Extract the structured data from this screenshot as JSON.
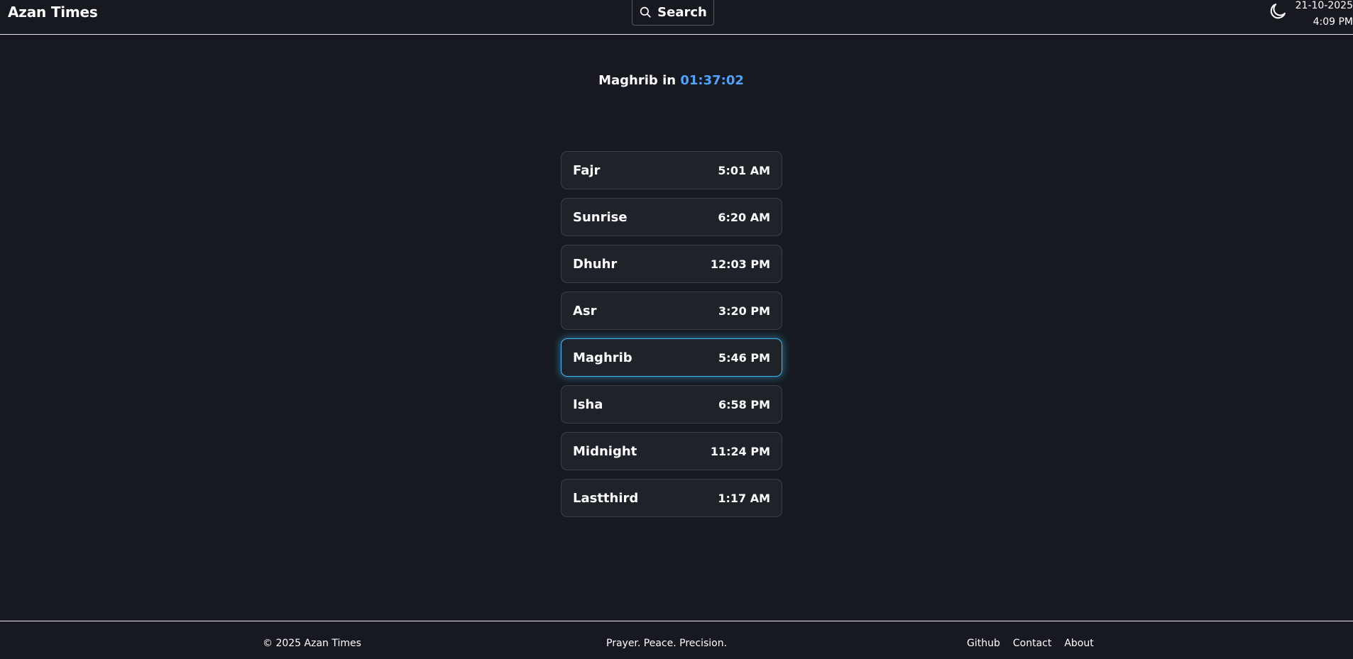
{
  "header": {
    "brand": "Azan Times",
    "search_label": "Search",
    "date": "21-10-2025",
    "time": "4:09 PM",
    "search_icon": "search-icon",
    "theme_icon": "moon-icon"
  },
  "countdown": {
    "prayer": "Maghrib",
    "connector": "in",
    "remaining": "01:37:02",
    "accent_color": "#4da3ff"
  },
  "prayers": [
    {
      "name": "Fajr",
      "time": "5:01 AM"
    },
    {
      "name": "Sunrise",
      "time": "6:20 AM"
    },
    {
      "name": "Dhuhr",
      "time": "12:03 PM"
    },
    {
      "name": "Asr",
      "time": "3:20 PM"
    },
    {
      "name": "Maghrib",
      "time": "5:46 PM"
    },
    {
      "name": "Isha",
      "time": "6:58 PM"
    },
    {
      "name": "Midnight",
      "time": "11:24 PM"
    },
    {
      "name": "Lastthird",
      "time": "1:17 AM"
    }
  ],
  "active_prayer": "Maghrib",
  "highlight_color": "#3fb8f0",
  "footer": {
    "copyright": "© 2025 Azan Times",
    "tagline": "Prayer. Peace. Precision.",
    "links": [
      "Github",
      "Contact",
      "About"
    ]
  }
}
